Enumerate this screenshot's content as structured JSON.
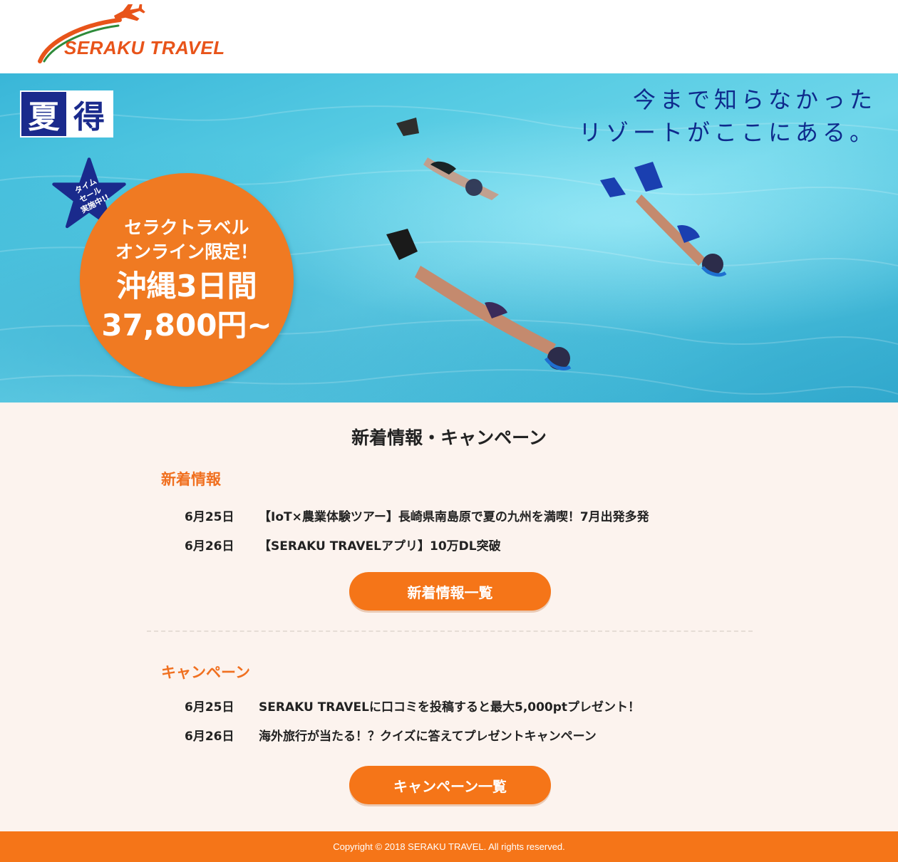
{
  "header": {
    "brand": "SERAKU TRAVEL",
    "colors": {
      "brand": "#e8541a",
      "accent": "#f57518"
    }
  },
  "hero": {
    "badge": {
      "left": "夏",
      "right": "得"
    },
    "tagline": [
      "今まで知らなかった",
      "リゾートがここにある。"
    ],
    "star_label": [
      "タイム",
      "セール",
      "実施中!!"
    ],
    "promo": {
      "line1": "セラクトラベル",
      "line2": "オンライン限定！",
      "line3": "沖縄3日間",
      "price": "37,800円~"
    }
  },
  "main": {
    "title": "新着情報・キャンペーン",
    "news": {
      "heading": "新着情報",
      "items": [
        {
          "date": "6月25日",
          "text": "【IoT×農業体験ツアー】長崎県南島原で夏の九州を満喫！7月出発多発"
        },
        {
          "date": "6月26日",
          "text": "【SERAKU TRAVELアプリ】10万DL突破"
        }
      ],
      "button": "新着情報一覧"
    },
    "campaign": {
      "heading": "キャンペーン",
      "items": [
        {
          "date": "6月25日",
          "text": "SERAKU TRAVELに口コミを投稿すると最大5,000ptプレゼント！"
        },
        {
          "date": "6月26日",
          "text": "海外旅行が当たる！？クイズに答えてプレゼントキャンペーン"
        }
      ],
      "button": "キャンペーン一覧"
    }
  },
  "footer": {
    "copyright": "Copyright © 2018 SERAKU TRAVEL. All rights reserved."
  }
}
